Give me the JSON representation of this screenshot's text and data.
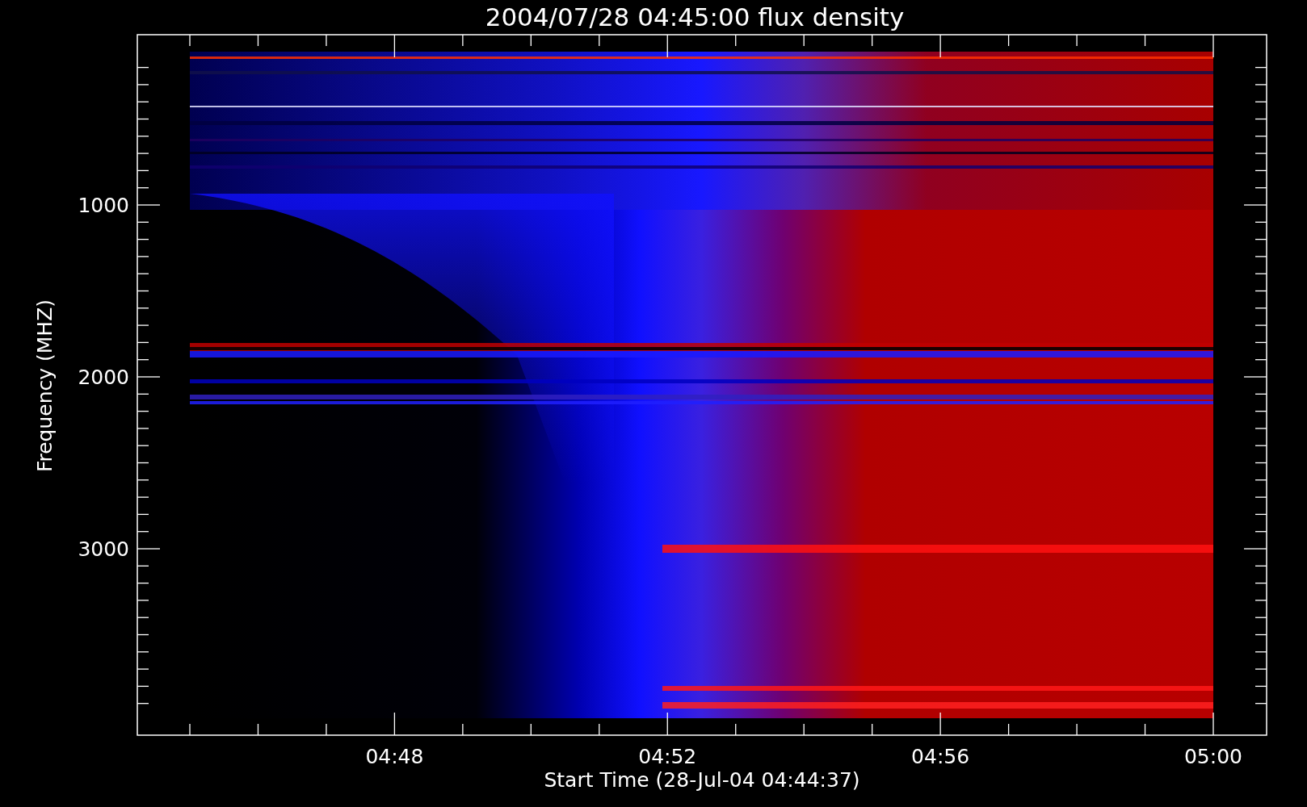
{
  "title": "2004/07/28 04:45:00 flux density",
  "plot": {
    "xlabel": "Start Time (28-Jul-04 04:44:37)",
    "ylabel": "Frequency (MHZ)",
    "xticks": [
      "04:48",
      "04:52",
      "04:56",
      "05:00"
    ],
    "yticks": [
      "1000",
      "2000",
      "3000"
    ]
  }
}
